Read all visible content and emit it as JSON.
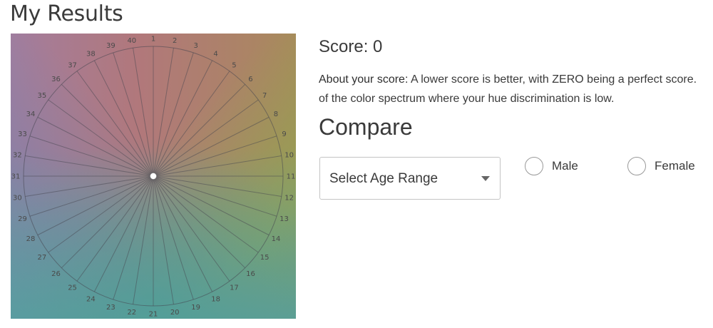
{
  "page": {
    "title": "My Results"
  },
  "wheel": {
    "segment_labels": [
      "1",
      "2",
      "3",
      "4",
      "5",
      "6",
      "7",
      "8",
      "9",
      "10",
      "11",
      "12",
      "13",
      "14",
      "15",
      "16",
      "17",
      "18",
      "19",
      "20",
      "21",
      "22",
      "23",
      "24",
      "25",
      "26",
      "27",
      "28",
      "29",
      "30",
      "31",
      "32",
      "33",
      "34",
      "35",
      "36",
      "37",
      "38",
      "39",
      "40"
    ],
    "score_value": 0
  },
  "results": {
    "score_text": "Score: 0",
    "about_label": "About your score:",
    "about_text_line1": " A lower score is better, with ZERO being a perfect score. ",
    "about_text_line2": "of the color spectrum where your hue discrimination is low."
  },
  "compare": {
    "heading": "Compare",
    "age_select": {
      "selected": "Select Age Range"
    },
    "gender_options": [
      {
        "label": "Male",
        "checked": false
      },
      {
        "label": "Female",
        "checked": false
      }
    ]
  }
}
